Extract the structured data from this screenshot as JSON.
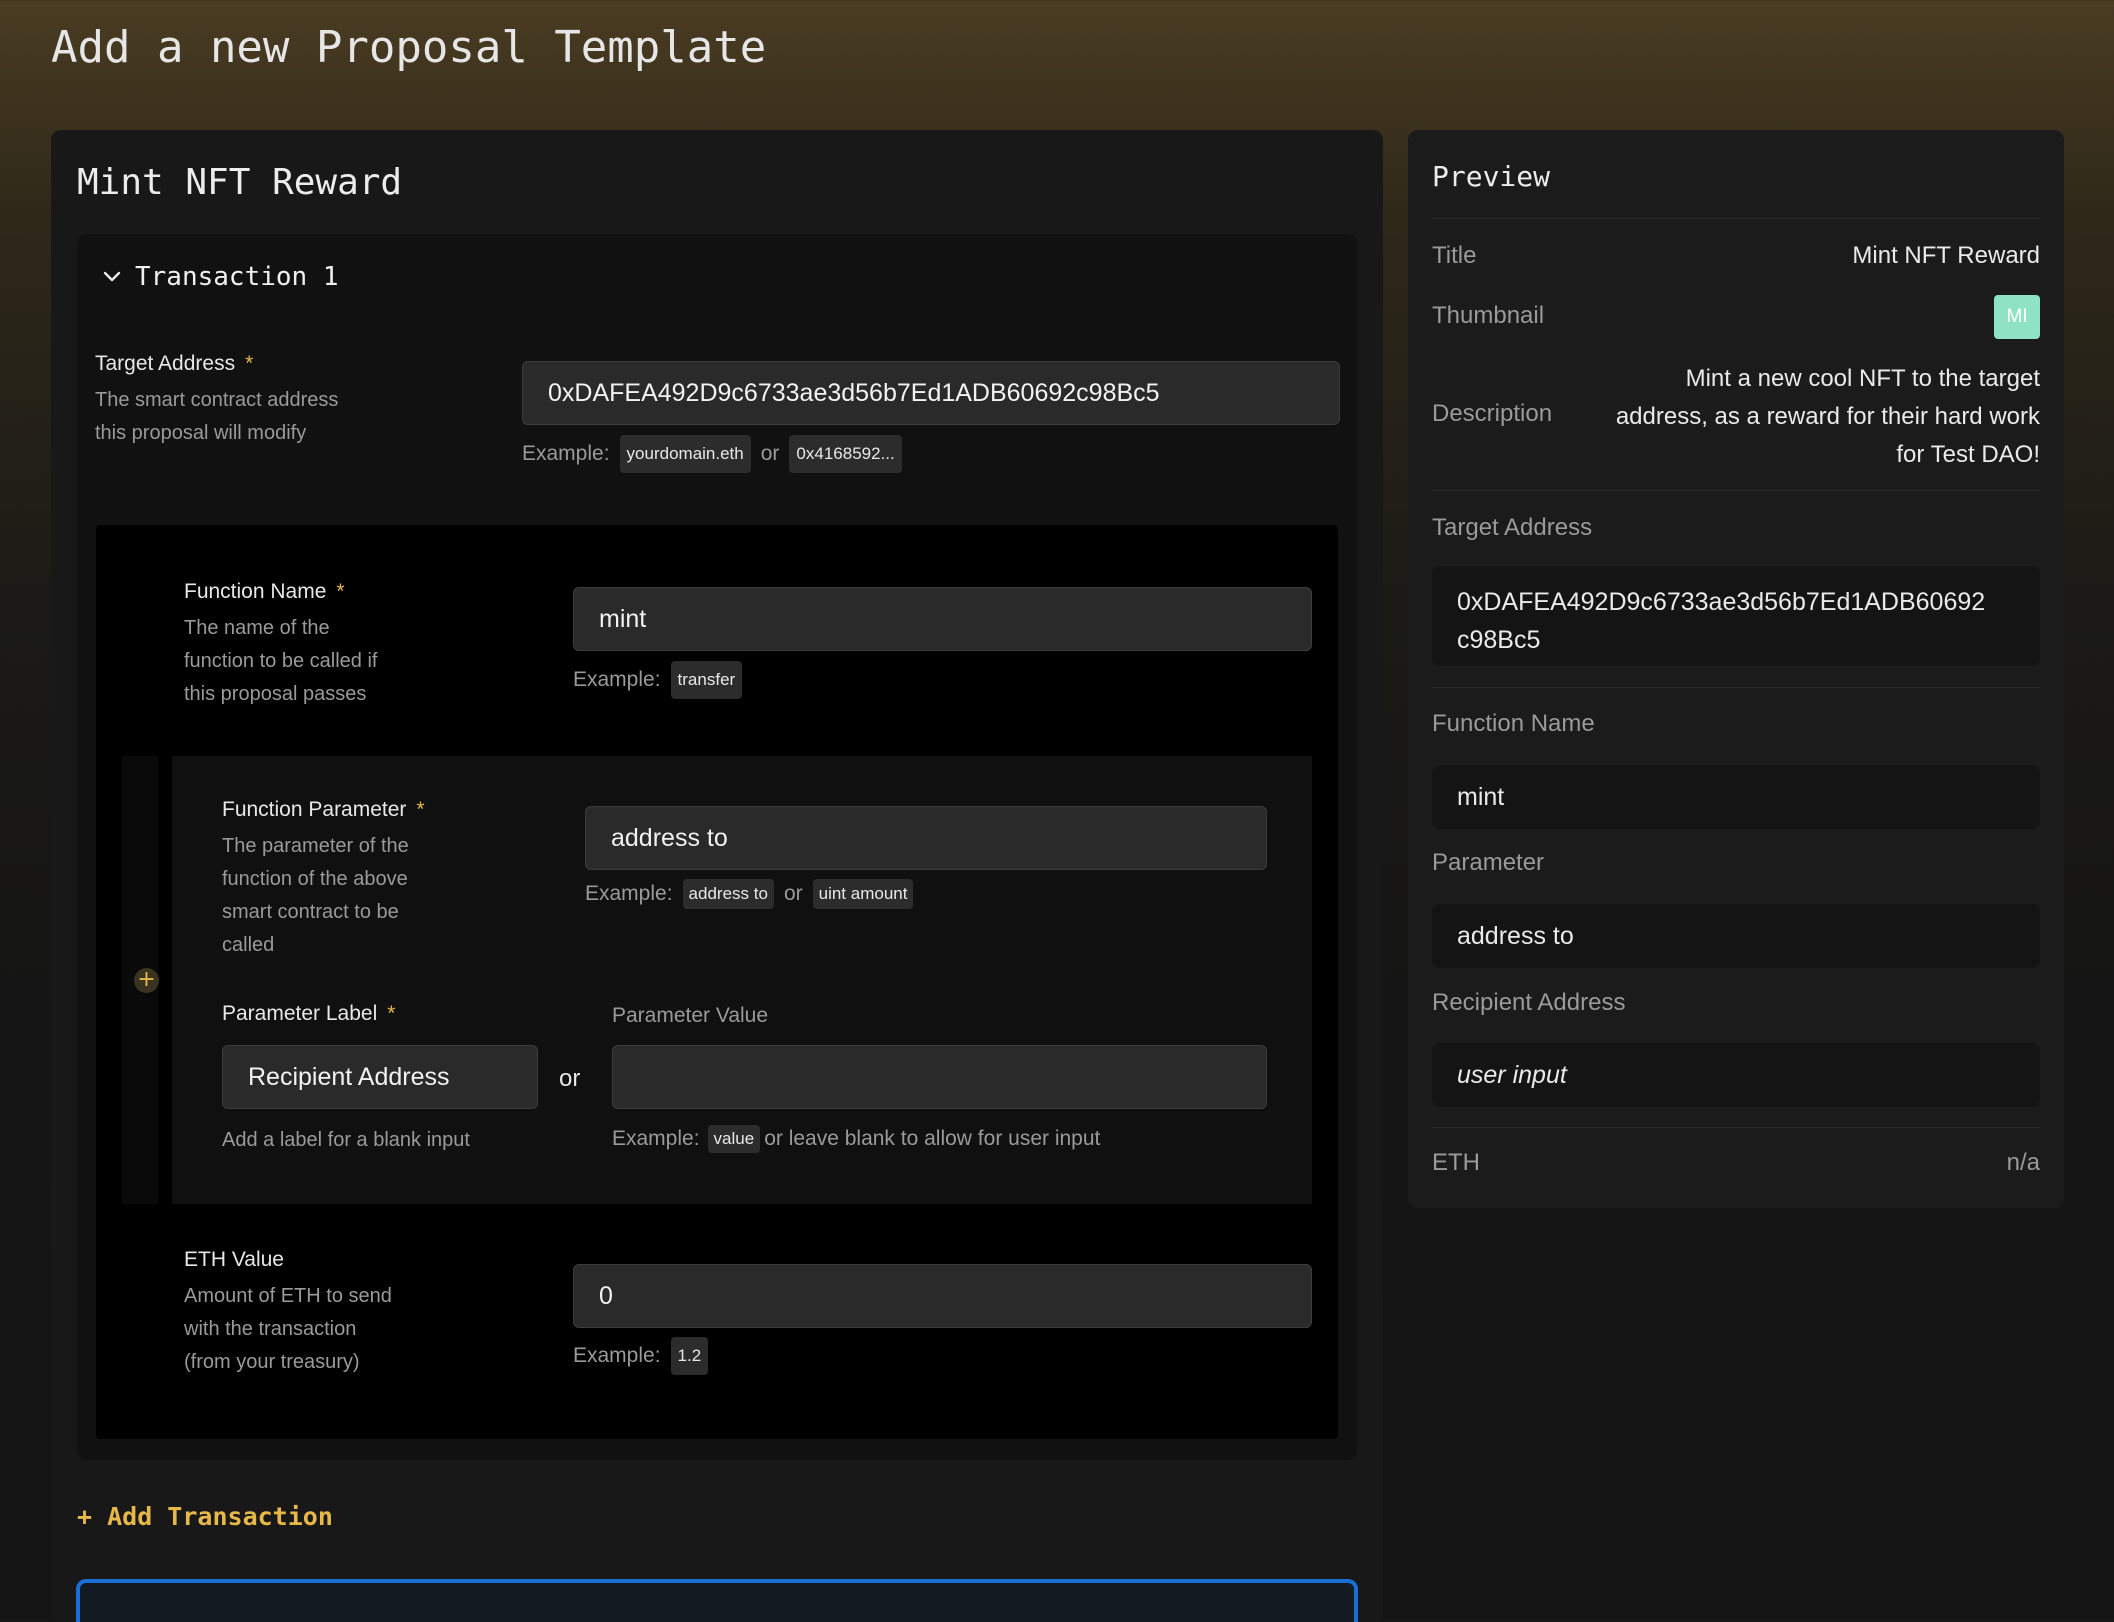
{
  "page": {
    "title": "Add a new Proposal Template"
  },
  "template": {
    "name": "Mint NFT Reward"
  },
  "transaction": {
    "title": "Transaction 1",
    "target_address": {
      "label": "Target Address",
      "required": "*",
      "description": [
        "The smart contract address",
        "this proposal will modify"
      ],
      "value": "0xDAFEA492D9c6733ae3d56b7Ed1ADB60692c98Bc5",
      "example_label": "Example:",
      "example_1": "yourdomain.eth",
      "or": "or",
      "example_2": "0x4168592..."
    },
    "function_name": {
      "label": "Function Name",
      "required": "*",
      "description": [
        "The name of the",
        "function to be called if",
        "this proposal passes"
      ],
      "value": "mint",
      "example_label": "Example:",
      "example": "transfer"
    },
    "function_parameter": {
      "label": "Function Parameter",
      "required": "*",
      "description": [
        "The parameter of the",
        "function of the above",
        "smart contract to be",
        "called"
      ],
      "value": "address to",
      "example_label": "Example:",
      "example_1": "address to",
      "or": "or",
      "example_2": "uint amount",
      "add_icon": "+"
    },
    "parameter_label": {
      "label": "Parameter Label",
      "required": "*",
      "value": "Recipient Address",
      "hint": "Add a label for a blank input"
    },
    "or_separator": "or",
    "parameter_value": {
      "label": "Parameter Value",
      "value": "",
      "example_label": "Example:",
      "example": "value",
      "example_suffix": "or leave blank to allow for user input"
    },
    "eth_value": {
      "label": "ETH Value",
      "description": [
        "Amount of ETH to send",
        "with the transaction",
        "(from your treasury)"
      ],
      "value": "0",
      "example_label": "Example:",
      "example": "1.2"
    }
  },
  "add_transaction_label": "+ Add Transaction",
  "preview": {
    "title": "Preview",
    "title_label": "Title",
    "title_value": "Mint NFT Reward",
    "thumbnail_label": "Thumbnail",
    "thumbnail_initials": "MI",
    "description_label": "Description",
    "description_value": [
      "Mint a new cool NFT to the target",
      "address, as a reward for their hard work",
      "for Test DAO!"
    ],
    "target_label": "Target Address",
    "target_value": [
      "0xDAFEA492D9c6733ae3d56b7Ed1ADB60692",
      "c98Bc5"
    ],
    "function_label": "Function Name",
    "function_value": "mint",
    "parameter_label": "Parameter",
    "parameter_value": "address to",
    "recipient_label": "Recipient Address",
    "recipient_value": "user input",
    "eth_label": "ETH",
    "eth_value": "n/a"
  },
  "colors": {
    "accent": "#e6b84a",
    "focus": "#1a6fd6",
    "thumbnail": "#8fe3c4"
  },
  "icons": {
    "collapse": "chevron-down-icon",
    "add_param": "plus-circle-icon"
  }
}
